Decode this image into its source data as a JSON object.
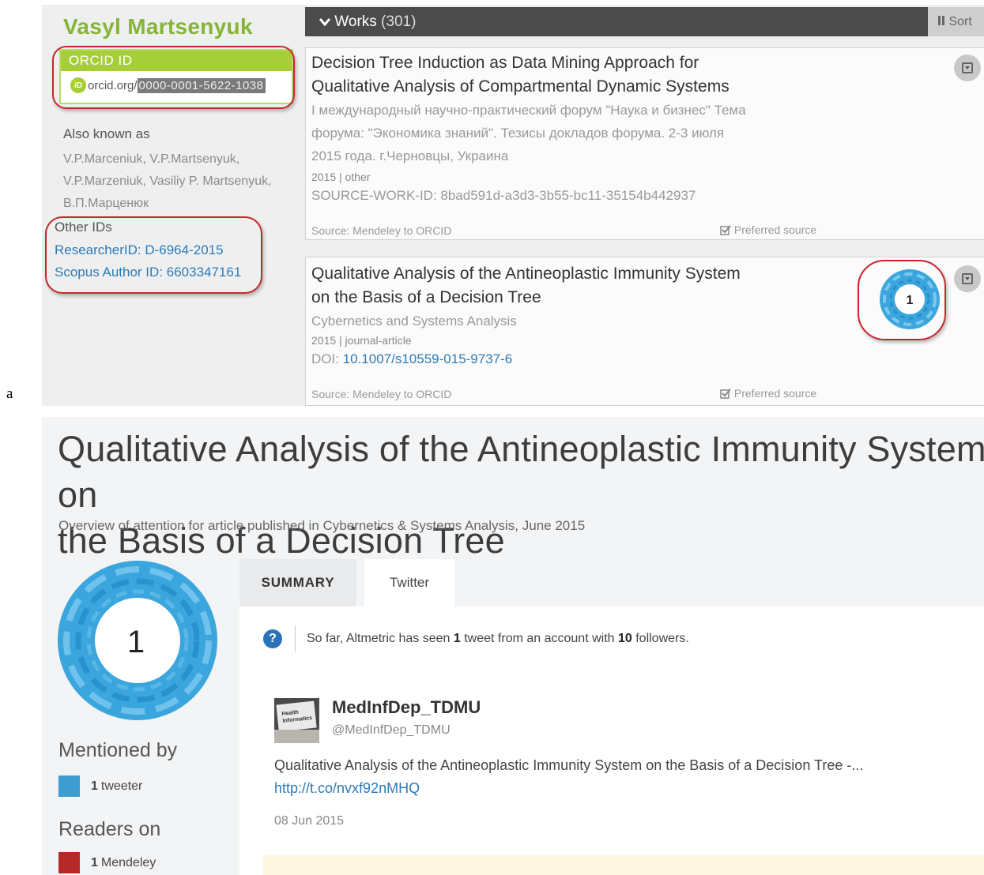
{
  "panel_label": "a",
  "orcid_profile": {
    "name": "Vasyl Martsenyuk",
    "orcid_box_title": "ORCID ID",
    "orcid_logo": "iD",
    "orcid_prefix": "orcid.org/",
    "orcid_number": "0000-0001-5622-1038",
    "also_known_label": "Also known as",
    "also_known_names": [
      "V.P.Marceniuk, V.P.Martsenyuk,",
      "V.P.Marzeniuk, Vasiliy P. Martsenyuk,",
      "В.П.Марценюк"
    ],
    "other_ids_label": "Other IDs",
    "other_ids": [
      "ResearcherID: D-6964-2015",
      "Scopus Author ID: 6603347161"
    ]
  },
  "works": {
    "header_label": "Works",
    "header_count": "(301)",
    "sort_label": "Sort",
    "items": [
      {
        "title_lines": [
          "Decision Tree Induction as Data Mining Approach for",
          "Qualitative Analysis of Compartmental Dynamic Systems"
        ],
        "body_lines": [
          "I международный научно-практический форум \"Наука и бизнес\" Тема",
          "форума: \"Экономика знаний\". Тезисы докладов форума. 2-3 июля",
          "2015 года. г.Черновцы, Украина"
        ],
        "meta": "2015 | other",
        "id_line": "SOURCE-WORK-ID: 8bad591d-a3d3-3b55-bc11-35154b442937",
        "source": "Source: Mendeley to ORCID",
        "preferred": "Preferred source"
      },
      {
        "title_lines": [
          "Qualitative Analysis of the Antineoplastic Immunity System",
          "on the Basis of a Decision Tree"
        ],
        "body_lines": [
          "Cybernetics and Systems Analysis"
        ],
        "meta": "2015 | journal-article",
        "doi_label": "DOI: ",
        "doi_value": "10.1007/s10559-015-9737-6",
        "badge_score": "1",
        "source": "Source: Mendeley to ORCID",
        "preferred": "Preferred source"
      }
    ]
  },
  "altmetric": {
    "title_line1": "Qualitative Analysis of the Antineoplastic Immunity System on",
    "title_line2": "the Basis of a Decision Tree",
    "subtitle": "Overview of attention for article published in Cybernetics & Systems Analysis, June 2015",
    "score": "1",
    "mentioned_by_label": "Mentioned by",
    "tweeter_count": "1",
    "tweeter_label": "tweeter",
    "readers_on_label": "Readers on",
    "mendeley_count": "1",
    "mendeley_label": "Mendeley",
    "tabs": [
      "SUMMARY",
      "Twitter"
    ],
    "help_icon": "?",
    "summary_prefix": "So far, Altmetric has seen ",
    "summary_tweets": "1",
    "summary_mid": " tweet from an account with ",
    "summary_followers": "10",
    "summary_suffix": " followers.",
    "tweet": {
      "author": "MedInfDep_TDMU",
      "handle": "@MedInfDep_TDMU",
      "avatar_text": "Health Informatics",
      "text": "Qualitative Analysis of the Antineoplastic Immunity System on the Basis of a Decision Tree -...",
      "link": "http://t.co/nvxf92nMHQ",
      "date": "08 Jun 2015"
    }
  },
  "colors": {
    "orcid_green": "#a6ce39",
    "name_green": "#84b537",
    "annotation_red": "#c5262c",
    "link_blue": "#2b7bb9",
    "twitter_legend": "#3d9cd2",
    "mendeley_legend": "#b52a28",
    "donut_blue": "#3aa6dd"
  },
  "icons": {
    "works_toggle": "chevron-down-icon",
    "sort": "sort-icon",
    "preferred": "checkbox-icon",
    "expand": "expand-icon",
    "help": "question-icon"
  }
}
